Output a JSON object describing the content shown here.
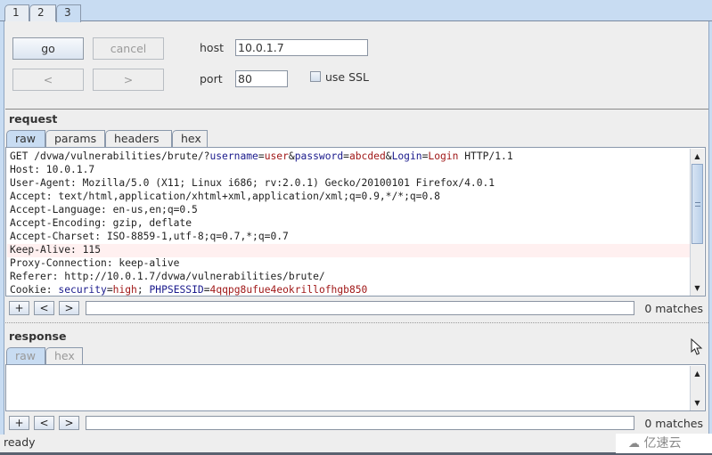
{
  "window_tabs": [
    {
      "label": "1",
      "active": false
    },
    {
      "label": "2",
      "active": false
    },
    {
      "label": "3",
      "active": true
    }
  ],
  "controls": {
    "go_label": "go",
    "cancel_label": "cancel",
    "back_label": "<",
    "forward_label": ">",
    "host_label": "host",
    "host_value": "10.0.1.7",
    "port_label": "port",
    "port_value": "80",
    "use_ssl_label": "use SSL",
    "use_ssl_checked": false
  },
  "request": {
    "title": "request",
    "tabs": [
      {
        "label": "raw",
        "active": true
      },
      {
        "label": "params",
        "active": false
      },
      {
        "label": "headers",
        "active": false
      },
      {
        "label": "hex",
        "active": false
      }
    ],
    "lines": [
      [
        {
          "t": "GET /dvwa/vulnerabilities/brute/?",
          "c": ""
        },
        {
          "t": "username",
          "c": "k"
        },
        {
          "t": "=",
          "c": ""
        },
        {
          "t": "user",
          "c": "v"
        },
        {
          "t": "&",
          "c": ""
        },
        {
          "t": "password",
          "c": "k"
        },
        {
          "t": "=",
          "c": ""
        },
        {
          "t": "abcded",
          "c": "v"
        },
        {
          "t": "&",
          "c": ""
        },
        {
          "t": "Login",
          "c": "k"
        },
        {
          "t": "=",
          "c": ""
        },
        {
          "t": "Login",
          "c": "v"
        },
        {
          "t": " HTTP/1.1",
          "c": ""
        }
      ],
      [
        {
          "t": "Host: 10.0.1.7",
          "c": ""
        }
      ],
      [
        {
          "t": "User-Agent: Mozilla/5.0 (X11; Linux i686; rv:2.0.1) Gecko/20100101 Firefox/4.0.1",
          "c": ""
        }
      ],
      [
        {
          "t": "Accept: text/html,application/xhtml+xml,application/xml;q=0.9,*/*;q=0.8",
          "c": ""
        }
      ],
      [
        {
          "t": "Accept-Language: en-us,en;q=0.5",
          "c": ""
        }
      ],
      [
        {
          "t": "Accept-Encoding: gzip, deflate",
          "c": ""
        }
      ],
      [
        {
          "t": "Accept-Charset: ISO-8859-1,utf-8;q=0.7,*;q=0.7",
          "c": ""
        }
      ],
      [
        {
          "t": "Keep-Alive: 115",
          "c": ""
        }
      ],
      [
        {
          "t": "Proxy-Connection: keep-alive",
          "c": ""
        }
      ],
      [
        {
          "t": "Referer: http://10.0.1.7/dvwa/vulnerabilities/brute/",
          "c": ""
        }
      ],
      [
        {
          "t": "Cookie: ",
          "c": ""
        },
        {
          "t": "security",
          "c": "k"
        },
        {
          "t": "=",
          "c": ""
        },
        {
          "t": "high",
          "c": "v"
        },
        {
          "t": "; ",
          "c": ""
        },
        {
          "t": "PHPSESSID",
          "c": "k"
        },
        {
          "t": "=",
          "c": ""
        },
        {
          "t": "4qqpg8ufue4eokrillofhgb850",
          "c": "v"
        }
      ]
    ],
    "highlighted_line_index": 7,
    "search": {
      "add_label": "+",
      "prev_label": "<",
      "next_label": ">",
      "value": "",
      "matches_text": "0 matches"
    }
  },
  "response": {
    "title": "response",
    "tabs": [
      {
        "label": "raw",
        "active": true
      },
      {
        "label": "hex",
        "active": false
      }
    ],
    "search": {
      "add_label": "+",
      "prev_label": "<",
      "next_label": ">",
      "value": "",
      "matches_text": "0 matches"
    }
  },
  "status_text": "ready",
  "watermark_text": "亿速云",
  "colors": {
    "accent_blue": "#c8dcf2",
    "param_name": "#1a1a8c",
    "param_value": "#a01818",
    "highlight_row": "#fff0f0"
  }
}
